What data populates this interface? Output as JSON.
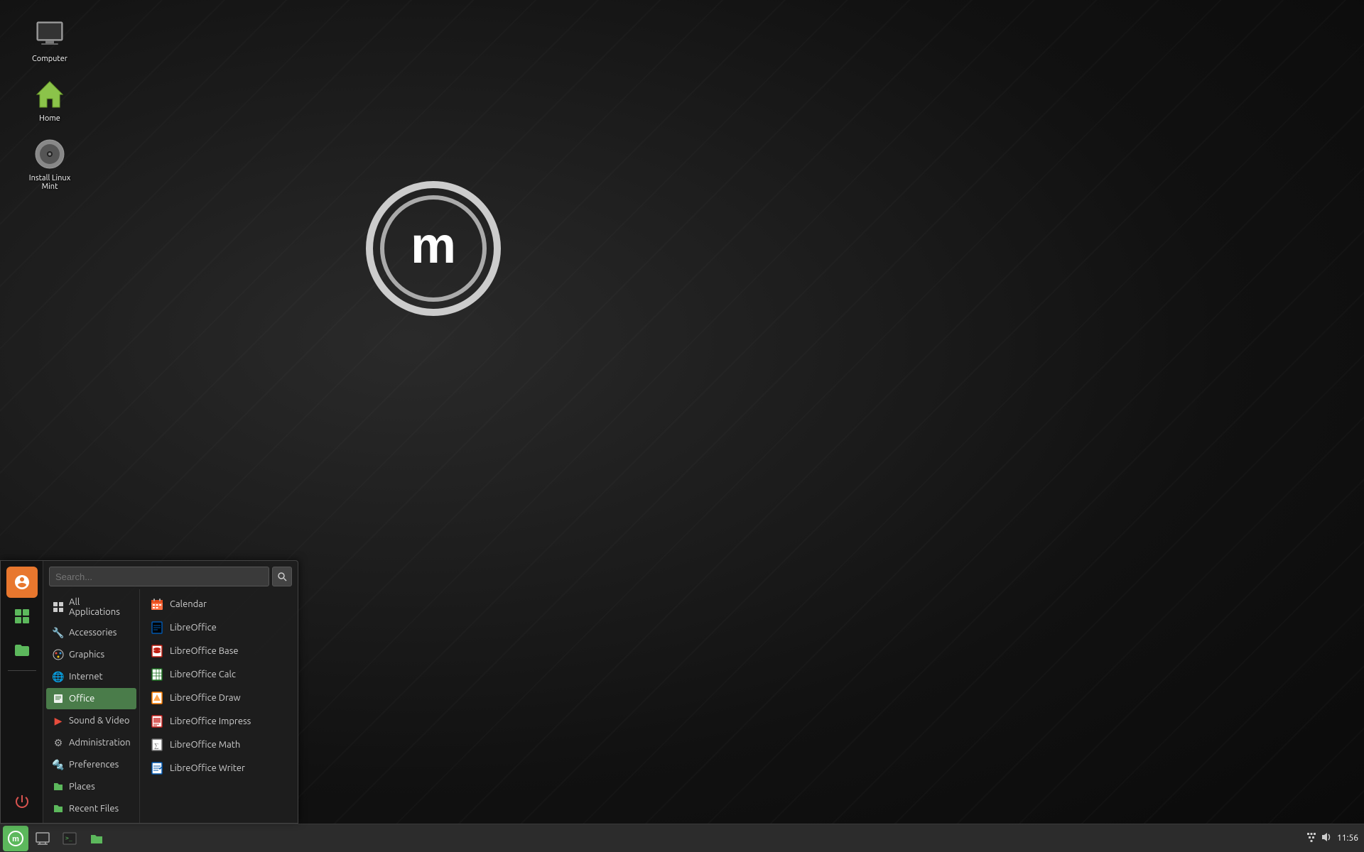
{
  "desktop": {
    "icons": [
      {
        "id": "computer",
        "label": "Computer",
        "icon": "🖥"
      },
      {
        "id": "home",
        "label": "Home",
        "icon": "🏠"
      },
      {
        "id": "install",
        "label": "Install Linux Mint",
        "icon": "💿"
      }
    ]
  },
  "taskbar": {
    "items": [
      {
        "id": "menu-btn",
        "icon": "🌿",
        "label": "Menu"
      },
      {
        "id": "show-desktop",
        "icon": "🖥",
        "label": "Show Desktop"
      },
      {
        "id": "terminal",
        "icon": "⬛",
        "label": "Terminal"
      },
      {
        "id": "files",
        "icon": "📁",
        "label": "Files"
      }
    ],
    "systray": {
      "network_icon": "⊞",
      "volume_icon": "🔊",
      "clock": "11:56"
    }
  },
  "app_menu": {
    "search_placeholder": "Search...",
    "sidebar_icons": [
      {
        "id": "favorites",
        "icon": "⭐",
        "color": "#e8772e"
      },
      {
        "id": "all-apps-grid",
        "icon": "⊞",
        "color": "#5cb85c"
      },
      {
        "id": "files-manager",
        "icon": "🗂",
        "color": "#5cb85c"
      },
      {
        "id": "power",
        "icon": "⏻",
        "color": "#d9534f"
      }
    ],
    "categories": [
      {
        "id": "all",
        "label": "All Applications",
        "icon": "⊞",
        "active": false
      },
      {
        "id": "accessories",
        "label": "Accessories",
        "icon": "🔧",
        "active": false
      },
      {
        "id": "graphics",
        "label": "Graphics",
        "icon": "🎨",
        "active": false
      },
      {
        "id": "internet",
        "label": "Internet",
        "icon": "🌐",
        "active": false
      },
      {
        "id": "office",
        "label": "Office",
        "icon": "📄",
        "active": true
      },
      {
        "id": "sound-video",
        "label": "Sound & Video",
        "icon": "🎬",
        "active": false
      },
      {
        "id": "administration",
        "label": "Administration",
        "icon": "⚙",
        "active": false
      },
      {
        "id": "preferences",
        "label": "Preferences",
        "icon": "🔩",
        "active": false
      },
      {
        "id": "places",
        "label": "Places",
        "icon": "📁",
        "active": false
      },
      {
        "id": "recent-files",
        "label": "Recent Files",
        "icon": "🕐",
        "active": false
      }
    ],
    "apps": [
      {
        "id": "calendar",
        "label": "Calendar",
        "icon": "📅",
        "color": "icon-orange"
      },
      {
        "id": "libreoffice",
        "label": "LibreOffice",
        "icon": "📄",
        "color": "lo-writer"
      },
      {
        "id": "libreoffice-base",
        "label": "LibreOffice Base",
        "icon": "🗄",
        "color": "lo-base"
      },
      {
        "id": "libreoffice-calc",
        "label": "LibreOffice Calc",
        "icon": "📊",
        "color": "lo-calc"
      },
      {
        "id": "libreoffice-draw",
        "label": "LibreOffice Draw",
        "icon": "✏",
        "color": "lo-draw"
      },
      {
        "id": "libreoffice-impress",
        "label": "LibreOffice Impress",
        "icon": "📽",
        "color": "lo-impress"
      },
      {
        "id": "libreoffice-math",
        "label": "LibreOffice Math",
        "icon": "∑",
        "color": "icon-gray"
      },
      {
        "id": "libreoffice-writer",
        "label": "LibreOffice Writer",
        "icon": "📝",
        "color": "lo-writer"
      }
    ]
  }
}
